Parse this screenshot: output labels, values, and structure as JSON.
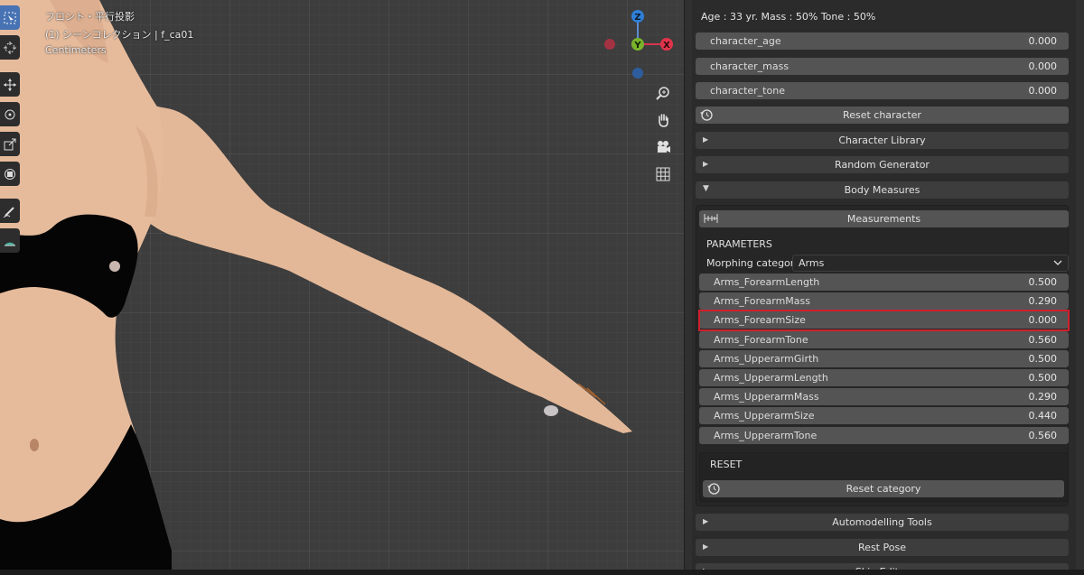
{
  "viewport": {
    "view_name": "フロント・平行投影",
    "collection": "(1) シーンコレクション | f_ca01",
    "units": "Centimeters",
    "gizmo": {
      "z": "Z",
      "y": "Y",
      "x": "X"
    },
    "tools": [
      "select-box-icon",
      "cursor-icon",
      "move-icon",
      "rotate-icon",
      "scale-icon",
      "transform-icon",
      "annotate-icon",
      "measure-icon"
    ],
    "nav": [
      "zoom-icon",
      "hand-icon",
      "camera-icon",
      "grid-icon"
    ]
  },
  "panel": {
    "status": "Age : 33 yr.  Mass : 50%  Tone : 50%",
    "character_fields": [
      {
        "label": "character_age",
        "value": "0.000"
      },
      {
        "label": "character_mass",
        "value": "0.000"
      },
      {
        "label": "character_tone",
        "value": "0.000"
      }
    ],
    "reset_character": "Reset character",
    "sections": {
      "character_library": "Character Library",
      "random_generator": "Random Generator",
      "body_measures": "Body Measures",
      "automodelling": "Automodelling Tools",
      "rest_pose": "Rest Pose",
      "skin_editor": "Skin Editor"
    },
    "measurements_button": "Measurements",
    "parameters_label": "PARAMETERS",
    "morph_category_label": "Morphing categor..",
    "morph_category_value": "Arms",
    "params": [
      {
        "label": "Arms_ForearmLength",
        "value": "0.500"
      },
      {
        "label": "Arms_ForearmMass",
        "value": "0.290"
      },
      {
        "label": "Arms_ForearmSize",
        "value": "0.000"
      },
      {
        "label": "Arms_ForearmTone",
        "value": "0.560"
      },
      {
        "label": "Arms_UpperarmGirth",
        "value": "0.500"
      },
      {
        "label": "Arms_UpperarmLength",
        "value": "0.500"
      },
      {
        "label": "Arms_UpperarmMass",
        "value": "0.290"
      },
      {
        "label": "Arms_UpperarmSize",
        "value": "0.440"
      },
      {
        "label": "Arms_UpperarmTone",
        "value": "0.560"
      }
    ],
    "reset_label": "RESET",
    "reset_category": "Reset category",
    "highlight_color": "#d0202c"
  }
}
